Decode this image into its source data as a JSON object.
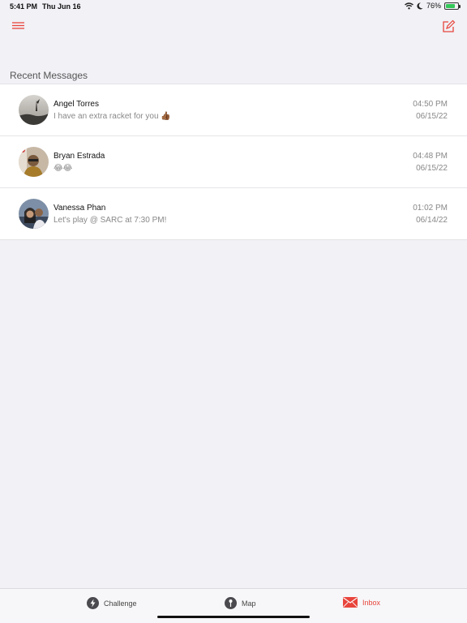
{
  "status_bar": {
    "time": "5:41 PM",
    "date": "Thu Jun 16",
    "battery": "76%",
    "battery_level": 0.76
  },
  "header": {
    "menu_icon": "hamburger-menu-icon",
    "compose_icon": "compose-icon"
  },
  "section_title": "Recent Messages",
  "conversations": [
    {
      "name": "Angel Torres",
      "preview": "I have an extra racket for you 👍🏾",
      "time": "04:50 PM",
      "date": "06/15/22"
    },
    {
      "name": "Bryan Estrada",
      "preview": "😂😂",
      "time": "04:48 PM",
      "date": "06/15/22"
    },
    {
      "name": "Vanessa Phan",
      "preview": "Let's play @ SARC at 7:30 PM!",
      "time": "01:02 PM",
      "date": "06/14/22"
    }
  ],
  "tabs": [
    {
      "label": "Challenge",
      "icon": "lightning-icon"
    },
    {
      "label": "Map",
      "icon": "map-pin-icon"
    },
    {
      "label": "Inbox",
      "icon": "mail-icon",
      "active": true
    }
  ],
  "colors": {
    "accent": "#e8453c",
    "background": "#f1f1f6"
  }
}
